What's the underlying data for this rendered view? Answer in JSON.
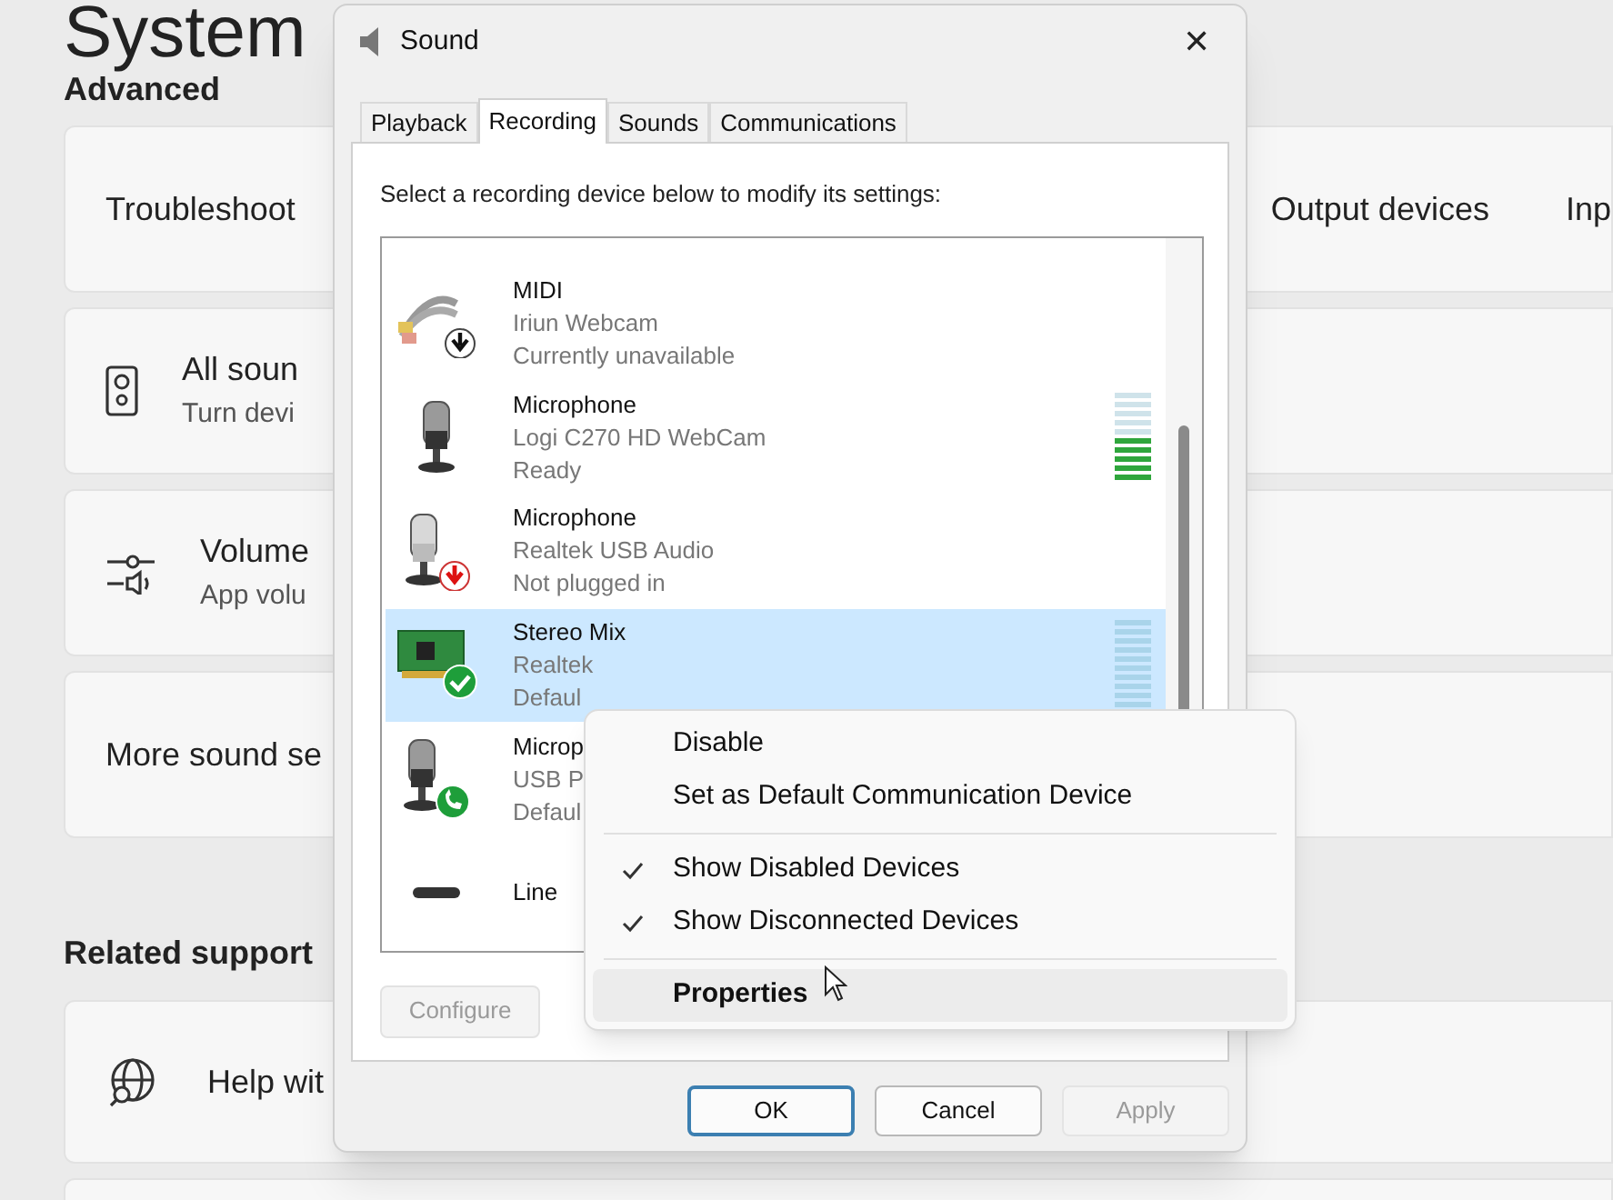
{
  "settings": {
    "title": "System",
    "section": "Advanced",
    "cards": [
      {
        "title": "Troubleshoot",
        "links": [
          "Output devices",
          "Inp"
        ]
      },
      {
        "title": "All soun",
        "subtitle": "Turn devi"
      },
      {
        "title": "Volume",
        "subtitle": "App volu"
      },
      {
        "title": "More sound se"
      }
    ],
    "related_title": "Related support",
    "support_cards": [
      {
        "title": "Help wit"
      }
    ]
  },
  "dialog": {
    "title": "Sound",
    "close": "✕",
    "tabs": [
      {
        "label": "Playback",
        "selected": false
      },
      {
        "label": "Recording",
        "selected": true
      },
      {
        "label": "Sounds",
        "selected": false
      },
      {
        "label": "Communications",
        "selected": false
      }
    ],
    "instruction": "Select a recording device below to modify its settings:",
    "devices": [
      {
        "kind": "cable-unavailable",
        "name": "MIDI",
        "detail": "Iriun Webcam",
        "state": "Currently unavailable",
        "selected": false
      },
      {
        "kind": "microphone",
        "name": "Microphone",
        "detail": "Logi C270 HD WebCam",
        "state": "Ready",
        "selected": false,
        "level": 0.5
      },
      {
        "kind": "microphone-unplugged",
        "name": "Microphone",
        "detail": "Realtek USB Audio",
        "state": "Not plugged in",
        "selected": false
      },
      {
        "kind": "card-default",
        "name": "Stereo Mix",
        "detail": "Realtek",
        "state": "Defaul",
        "selected": true,
        "level": 0
      },
      {
        "kind": "microphone-communication",
        "name": "Microp",
        "detail": "USB P",
        "state": "Defaul",
        "selected": false
      },
      {
        "kind": "line",
        "name": "Line",
        "selected": false
      }
    ],
    "configure": {
      "label": "Configure",
      "disabled": true
    },
    "buttons": [
      {
        "label": "OK",
        "disabled": false,
        "focused": true
      },
      {
        "label": "Cancel",
        "disabled": false,
        "focused": false
      },
      {
        "label": "Apply",
        "disabled": true,
        "focused": false
      }
    ]
  },
  "context_menu": {
    "items": [
      {
        "kind": "item",
        "label": "Disable",
        "checked": false,
        "selected": false
      },
      {
        "kind": "item",
        "label": "Set as Default Communication Device",
        "checked": false,
        "selected": false
      },
      {
        "kind": "separator"
      },
      {
        "kind": "item",
        "label": "Show Disabled Devices",
        "checked": true,
        "selected": false
      },
      {
        "kind": "item",
        "label": "Show Disconnected Devices",
        "checked": true,
        "selected": false
      },
      {
        "kind": "separator"
      },
      {
        "kind": "item",
        "label": "Properties",
        "checked": false,
        "selected": true,
        "bold": true
      }
    ]
  }
}
